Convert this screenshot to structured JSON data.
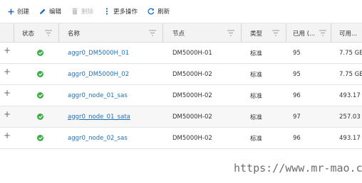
{
  "toolbar": {
    "items": [
      {
        "label": "创建",
        "icon": "plus-icon",
        "enabled": true
      },
      {
        "label": "编辑",
        "icon": "pencil-icon",
        "enabled": true
      },
      {
        "label": "删除",
        "icon": "trash-icon",
        "enabled": false
      },
      {
        "label": "更多操作",
        "icon": "vertical-dots-icon",
        "enabled": true
      },
      {
        "label": "刷新",
        "icon": "refresh-icon",
        "enabled": true
      }
    ]
  },
  "table": {
    "columns": [
      "状态",
      "名称",
      "节点",
      "类型",
      "已用 (...",
      "可用..."
    ],
    "rows": [
      {
        "expander": "+",
        "status": "online",
        "name": "aggr0_DM5000H_01",
        "node": "DM5000H-01",
        "type": "标准",
        "used": "95",
        "available": "7.75 GE"
      },
      {
        "expander": "+",
        "status": "online",
        "name": "aggr0_DM5000H_02",
        "node": "DM5000H-02",
        "type": "标准",
        "used": "95",
        "available": "7.75 GE"
      },
      {
        "expander": "+",
        "status": "online",
        "name": "aggr0_node_01_sas",
        "node": "DM5000H-02",
        "type": "标准",
        "used": "96",
        "available": "493.17"
      },
      {
        "expander": "+",
        "status": "online",
        "name": "aggr0_node_01_sata",
        "node": "DM5000H-02",
        "type": "标准",
        "used": "97",
        "available": "257.03"
      },
      {
        "expander": "+",
        "status": "online",
        "name": "aggr0_node_02_sas",
        "node": "DM5000H-02",
        "type": "标准",
        "used": "96",
        "available": "493.17"
      }
    ]
  },
  "watermark": "https://www.mr-mao.cn",
  "colors": {
    "accent": "#1e6fb8",
    "status_ok": "#3fae46",
    "header_bg": "#f3f3f3"
  }
}
